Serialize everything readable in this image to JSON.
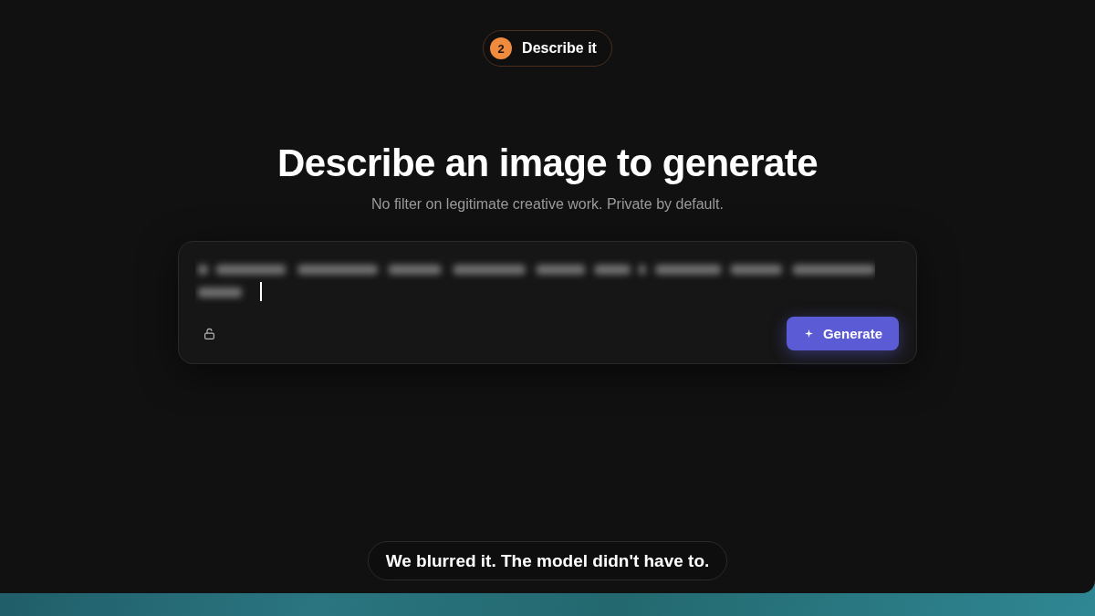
{
  "step": {
    "number": "2",
    "label": "Describe it"
  },
  "heading": "Describe an image to generate",
  "subtitle": "No filter on legitimate creative work. Private by default.",
  "prompt": {
    "button": "Generate"
  },
  "caption": "We blurred it. The model didn't have to."
}
